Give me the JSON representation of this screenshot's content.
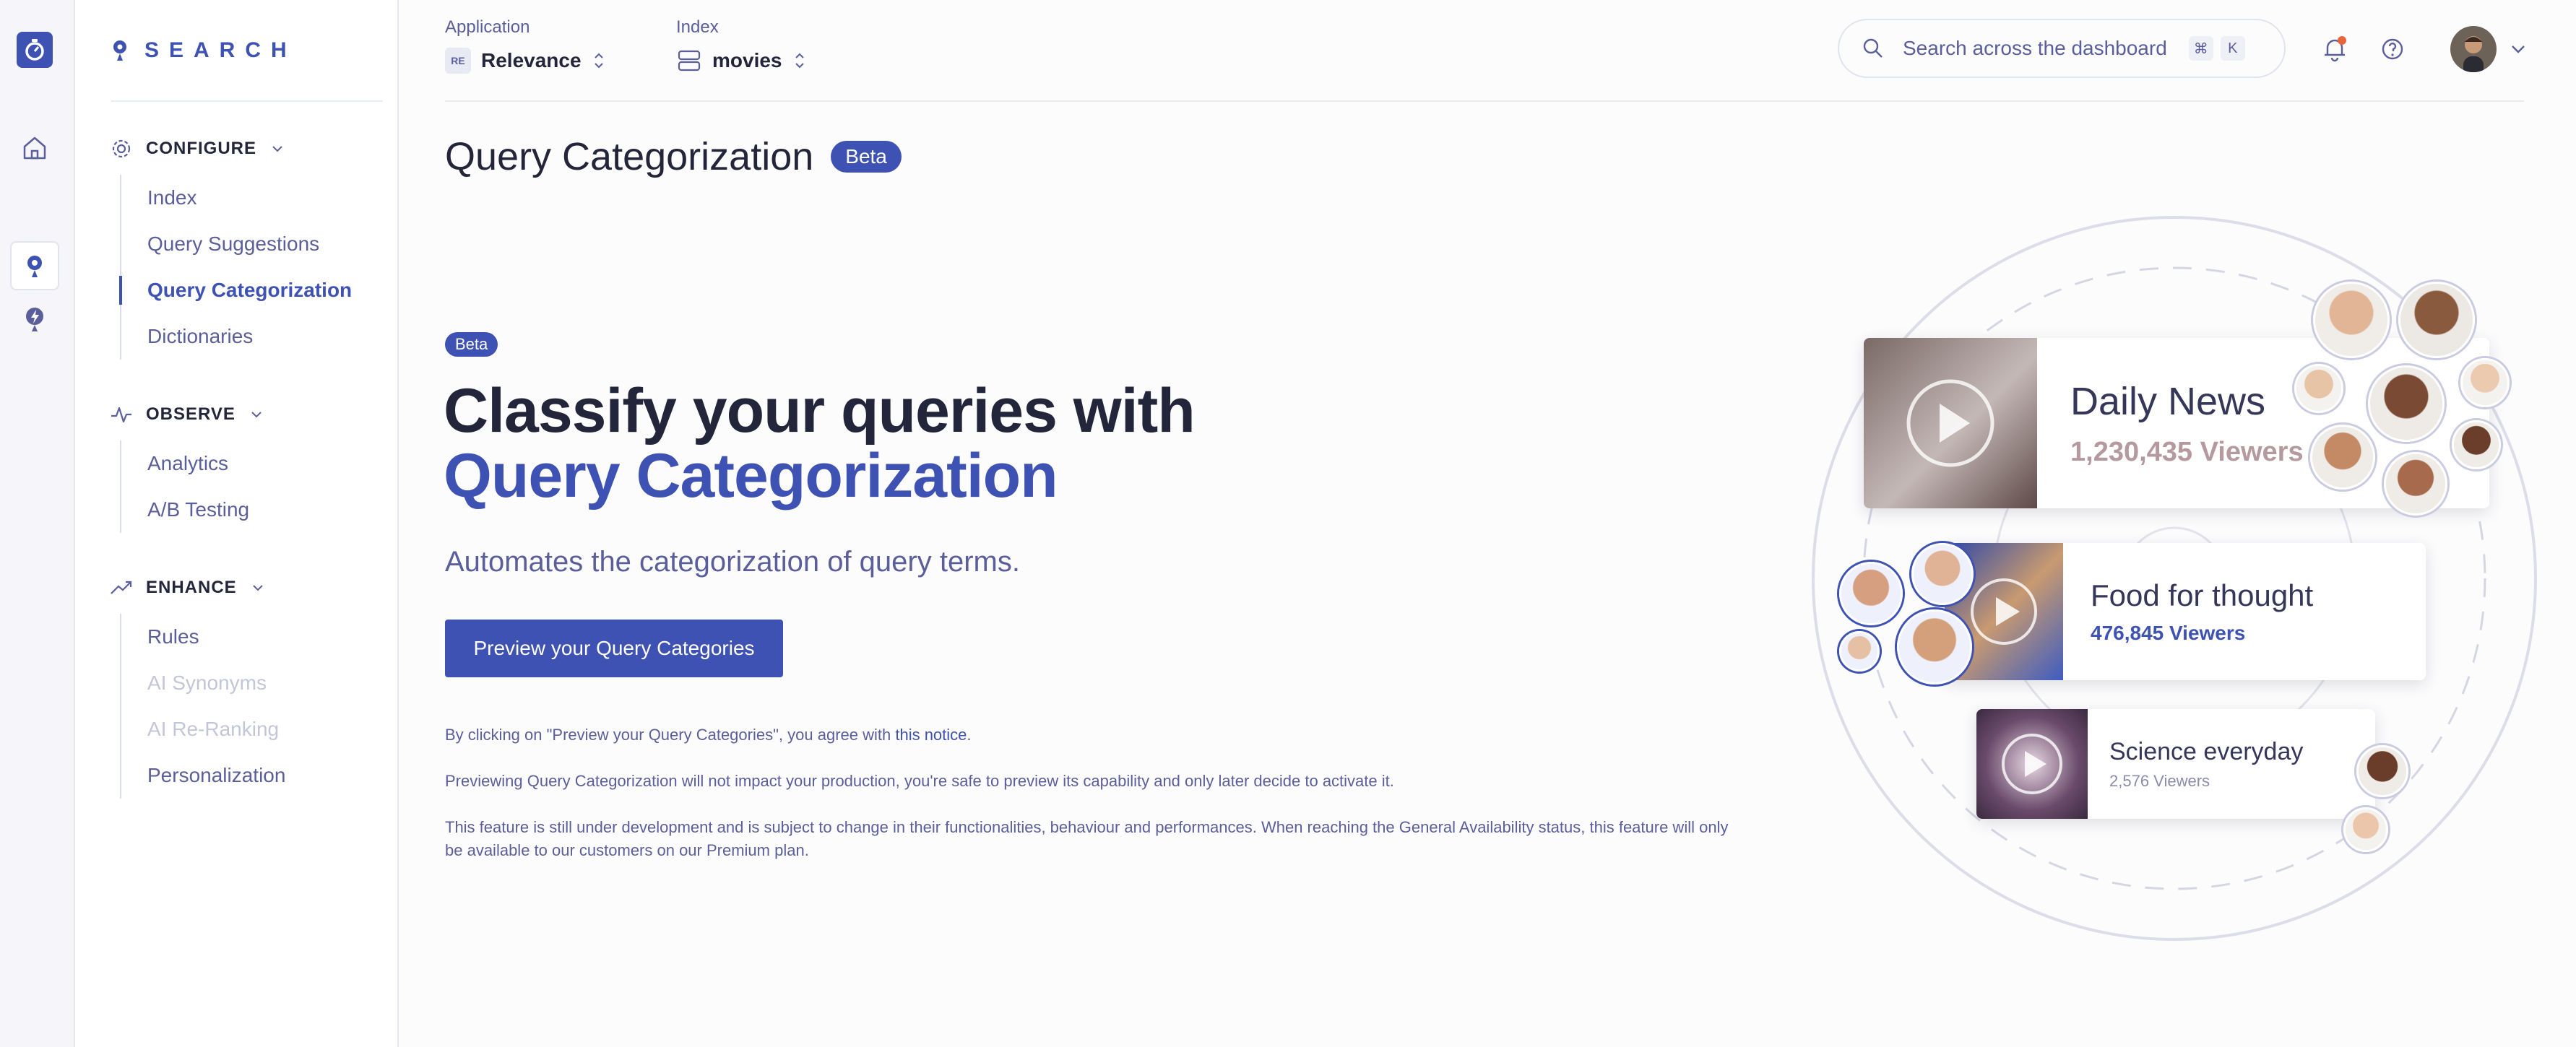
{
  "brand": {
    "name": "SEARCH"
  },
  "sidebar": {
    "groups": [
      {
        "title": "CONFIGURE",
        "items": [
          "Index",
          "Query Suggestions",
          "Query Categorization",
          "Dictionaries"
        ]
      },
      {
        "title": "OBSERVE",
        "items": [
          "Analytics",
          "A/B Testing"
        ]
      },
      {
        "title": "ENHANCE",
        "items": [
          "Rules",
          "AI Synonyms",
          "AI Re-Ranking",
          "Personalization"
        ]
      }
    ],
    "active_item": "Query Categorization",
    "disabled_items": [
      "AI Synonyms",
      "AI Re-Ranking"
    ]
  },
  "header": {
    "application": {
      "label": "Application",
      "badge": "RE",
      "value": "Relevance"
    },
    "index": {
      "label": "Index",
      "value": "movies"
    },
    "search": {
      "placeholder": "Search across the dashboard",
      "shortcut_1": "⌘",
      "shortcut_2": "K"
    },
    "notification_dot_color": "#e8663c"
  },
  "page": {
    "title": "Query Categorization",
    "title_badge": "Beta",
    "section_badge": "Beta",
    "hero_line1": "Classify your queries with",
    "hero_line2": "Query Categorization",
    "subtitle": "Automates the categorization of query terms.",
    "cta": "Preview your Query Categories",
    "notice_prefix": "By clicking on \"Preview your Query Categories\", you agree with ",
    "notice_link": "this notice",
    "notice_suffix": ".",
    "note_1": "Previewing Query Categorization will not impact your production, you're safe to preview its capability and only later decide to activate it.",
    "note_2": "This feature is still under development and is subject to change in their functionalities, behaviour and performances. When reaching the General Availability status, this feature will only be available to our customers on our Premium plan."
  },
  "illustration": {
    "cards": [
      {
        "title": "Daily News",
        "viewers": "1,230,435 Viewers"
      },
      {
        "title": "Food for thought",
        "viewers": "476,845 Viewers"
      },
      {
        "title": "Science everyday",
        "viewers": "2,576 Viewers"
      }
    ]
  },
  "colors": {
    "accent": "#3e52b3",
    "text": "#23263b",
    "muted": "#5a5e9a",
    "disabled": "#c4c6d8"
  }
}
